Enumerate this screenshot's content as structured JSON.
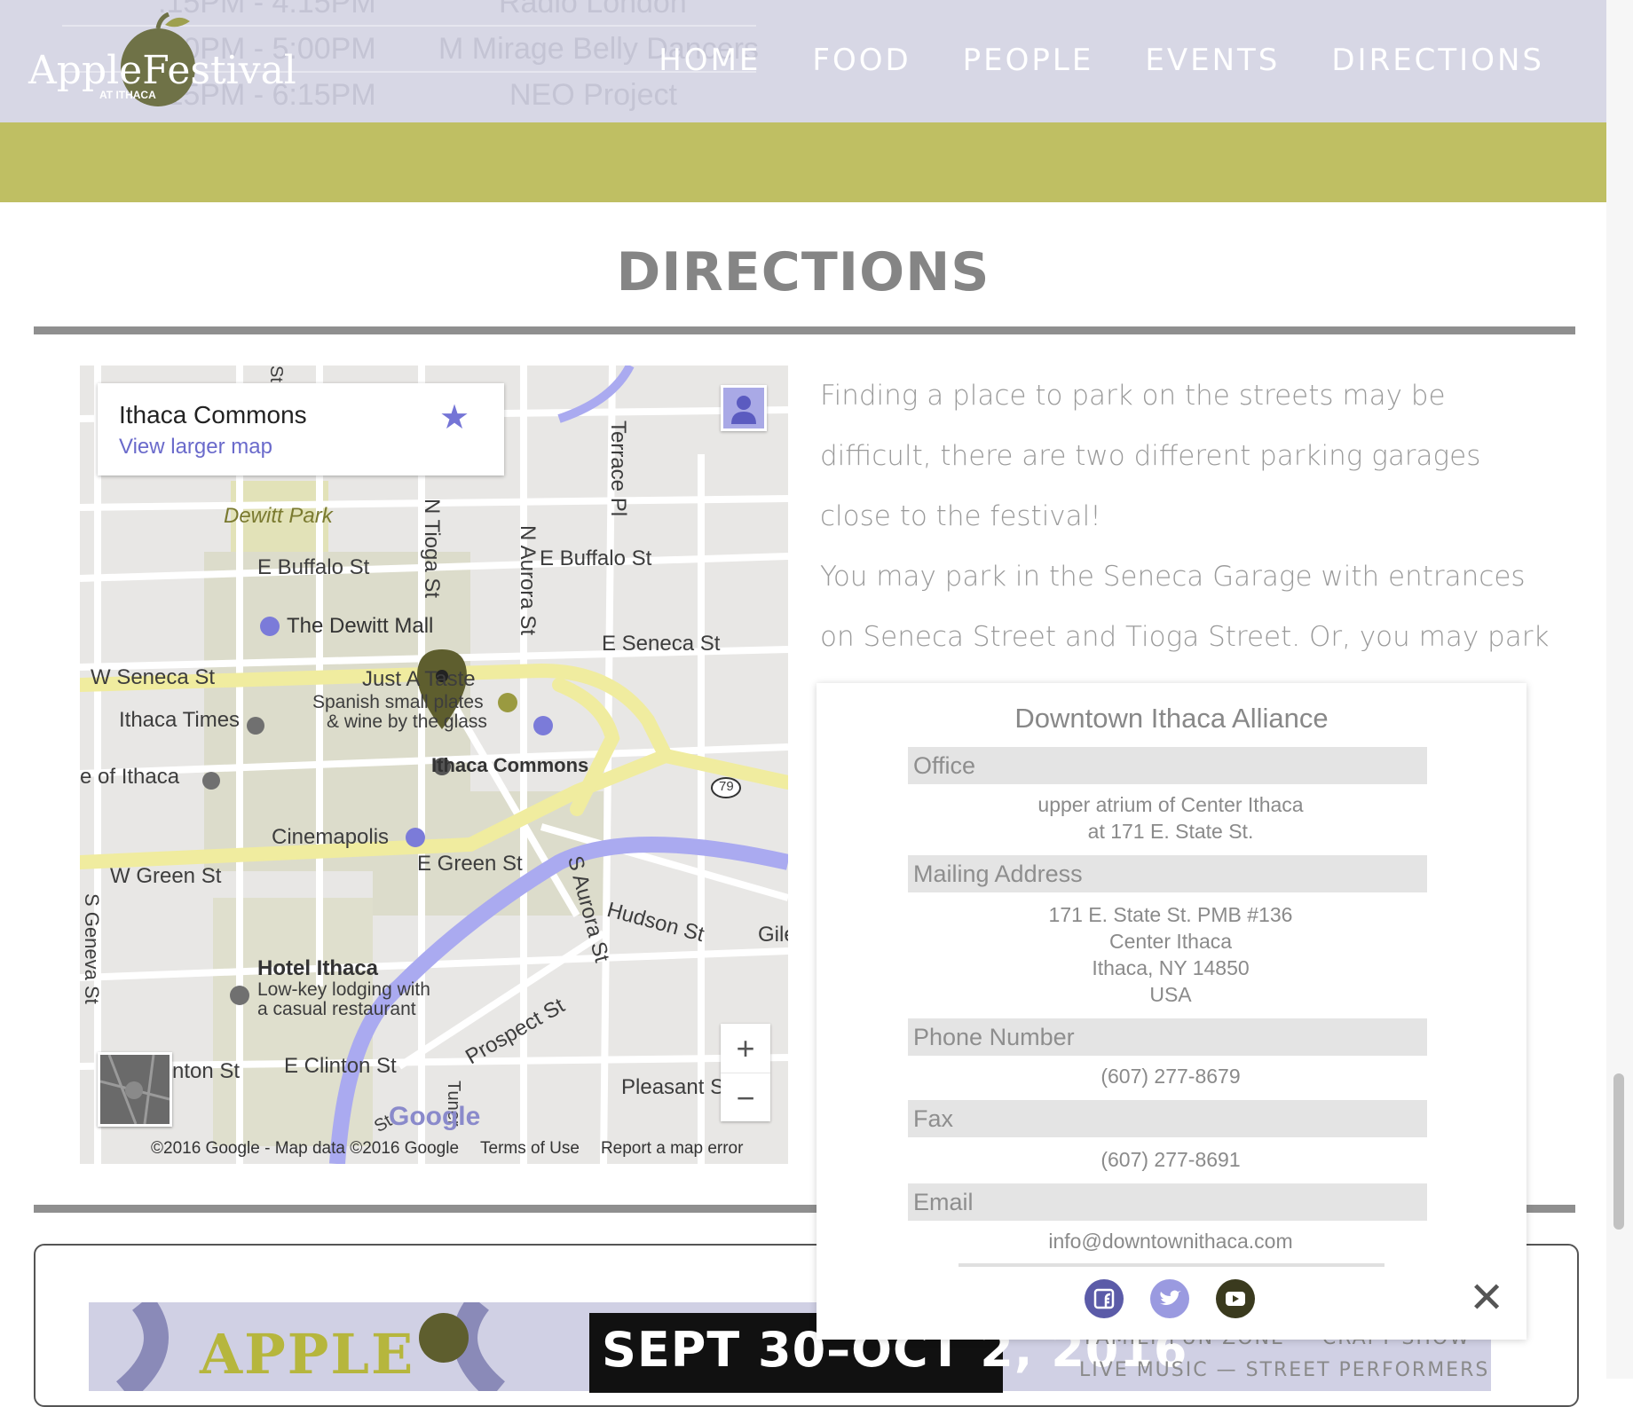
{
  "header": {
    "logo_text": "AppleFestival",
    "logo_subtext": "AT ITHACA",
    "nav": [
      "HOME",
      "FOOD",
      "PEOPLE",
      "EVENTS",
      "DIRECTIONS"
    ],
    "ghost_rows": [
      {
        "time": ":15PM - 4:15PM",
        "act": "Radio London"
      },
      {
        "time": ":00PM - 5:00PM",
        "act": "M Mirage Belly Dancers"
      },
      {
        "time": ":15PM - 6:15PM",
        "act": "NEO Project"
      }
    ],
    "band_color": "#bfbf63",
    "header_color": "#d7d7e5"
  },
  "directions": {
    "title": "DIRECTIONS",
    "paragraph_1": "Finding a place to park on the streets may be difficult, there are two different parking garages close to the festival!",
    "paragraph_2": "You may park in the Seneca Garage with entrances on Seneca Street and Tioga Street. Or, you may park in"
  },
  "map": {
    "place_name": "Ithaca Commons",
    "view_larger": "View larger map",
    "labels": {
      "terrace_pl": "Terrace Pl",
      "dewitt_park": "Dewitt Park",
      "n_tioga": "N Tioga St",
      "n_aurora": "N Aurora St",
      "e_buffalo_1": "E Buffalo St",
      "e_buffalo_2": "E Buffalo St",
      "dewitt_mall": "The Dewitt Mall",
      "e_seneca": "E Seneca St",
      "w_seneca": "W Seneca St",
      "just_a_taste": "Just A Taste",
      "taste_desc_1": "Spanish small plates",
      "taste_desc_2": "& wine by the glass",
      "ithaca_times": "Ithaca Times",
      "ithaca_commons": "Ithaca Commons",
      "of_ithaca": "e of Ithaca",
      "route_79": "79",
      "cinemapolis": "Cinemapolis",
      "w_green": "W Green St",
      "e_green": "E Green St",
      "s_aurora": "S Aurora St",
      "hudson": "Hudson St",
      "gile": "Gile",
      "s_geneva": "S Geneva St",
      "hotel_ithaca": "Hotel Ithaca",
      "hotel_desc_1": "Low-key lodging with",
      "hotel_desc_2": "a casual restaurant",
      "prospect": "Prospect St",
      "clinton_w": "nton St",
      "e_clinton": "E Clinton St",
      "pleasant": "Pleasant S",
      "tuner": "Tuner",
      "st_short": "St",
      "top_st": "St"
    },
    "google_word": "Google",
    "footer": {
      "copyright": "©2016 Google - Map data ©2016 Google",
      "terms": "Terms of Use",
      "report": "Report a map error"
    },
    "zoom_in": "+",
    "zoom_out": "−"
  },
  "popup": {
    "title": "Downtown Ithaca Alliance",
    "office_label": "Office",
    "office_lines": [
      "upper atrium of Center Ithaca",
      "at 171 E. State St."
    ],
    "mailing_label": "Mailing Address",
    "mailing_lines": [
      "171 E. State St. PMB #136",
      "Center Ithaca",
      "Ithaca, NY 14850",
      "USA"
    ],
    "phone_label": "Phone Number",
    "phone": "(607) 277-8679",
    "fax_label": "Fax",
    "fax": "(607) 277-8691",
    "email_label": "Email",
    "email": "info@downtownithaca.com",
    "close": "✕"
  },
  "poster": {
    "apple_text": "APPLE",
    "date_text": "SEPT 30–OCT 2, 2016",
    "line_1": "FAMILY FUN ZONE — CRAFT SHOW",
    "line_2": "LIVE MUSIC — STREET PERFORMERS"
  }
}
